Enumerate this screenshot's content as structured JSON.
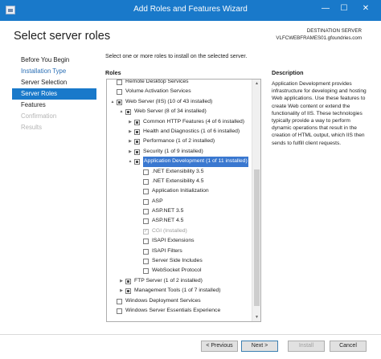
{
  "window": {
    "title": "Add Roles and Features Wizard",
    "minimize_glyph": "—",
    "maximize_glyph": "☐",
    "close_glyph": "✕"
  },
  "header": {
    "page_title": "Select server roles",
    "destination_label": "DESTINATION SERVER",
    "destination_server": "VLFCWEBFRAMES01.gfoundries.com"
  },
  "nav": {
    "items": [
      {
        "label": "Before You Begin",
        "state": "normal"
      },
      {
        "label": "Installation Type",
        "state": "link"
      },
      {
        "label": "Server Selection",
        "state": "normal"
      },
      {
        "label": "Server Roles",
        "state": "active"
      },
      {
        "label": "Features",
        "state": "normal"
      },
      {
        "label": "Confirmation",
        "state": "disabled"
      },
      {
        "label": "Results",
        "state": "disabled"
      }
    ]
  },
  "main": {
    "intro": "Select one or more roles to install on the selected server.",
    "roles_label": "Roles",
    "description_label": "Description",
    "description_text": "Application Development provides infrastructure for developing and hosting Web applications. Use these features to create Web content or extend the functionality of IIS. These technologies typically provide a way to perform dynamic operations that result in the creation of HTML output, which IIS then sends to fulfill client requests."
  },
  "roles_tree": [
    {
      "label": "Remote Desktop Services",
      "level": 0,
      "expander": "",
      "check": "unchecked"
    },
    {
      "label": "Volume Activation Services",
      "level": 0,
      "expander": "",
      "check": "unchecked"
    },
    {
      "label": "Web Server (IIS) (10 of 43 installed)",
      "level": 0,
      "expander": "▲",
      "check": "partial"
    },
    {
      "label": "Web Server (8 of 34 installed)",
      "level": 1,
      "expander": "▲",
      "check": "partial"
    },
    {
      "label": "Common HTTP Features (4 of 6 installed)",
      "level": 2,
      "expander": "▶",
      "check": "partial"
    },
    {
      "label": "Health and Diagnostics (1 of 6 installed)",
      "level": 2,
      "expander": "▶",
      "check": "partial"
    },
    {
      "label": "Performance (1 of 2 installed)",
      "level": 2,
      "expander": "▶",
      "check": "partial"
    },
    {
      "label": "Security (1 of 9 installed)",
      "level": 2,
      "expander": "▶",
      "check": "partial"
    },
    {
      "label": "Application Development (1 of 11 installed)",
      "level": 2,
      "expander": "▲",
      "check": "partial",
      "highlight": true
    },
    {
      "label": ".NET Extensibility 3.5",
      "level": 3,
      "expander": "",
      "check": "unchecked"
    },
    {
      "label": ".NET Extensibility 4.5",
      "level": 3,
      "expander": "",
      "check": "unchecked"
    },
    {
      "label": "Application Initialization",
      "level": 3,
      "expander": "",
      "check": "unchecked"
    },
    {
      "label": "ASP",
      "level": 3,
      "expander": "",
      "check": "unchecked"
    },
    {
      "label": "ASP.NET 3.5",
      "level": 3,
      "expander": "",
      "check": "unchecked"
    },
    {
      "label": "ASP.NET 4.5",
      "level": 3,
      "expander": "",
      "check": "unchecked"
    },
    {
      "label": "CGI (Installed)",
      "level": 3,
      "expander": "",
      "check": "checked",
      "disabled": true
    },
    {
      "label": "ISAPI Extensions",
      "level": 3,
      "expander": "",
      "check": "unchecked"
    },
    {
      "label": "ISAPI Filters",
      "level": 3,
      "expander": "",
      "check": "unchecked"
    },
    {
      "label": "Server Side Includes",
      "level": 3,
      "expander": "",
      "check": "unchecked"
    },
    {
      "label": "WebSocket Protocol",
      "level": 3,
      "expander": "",
      "check": "unchecked"
    },
    {
      "label": "FTP Server (1 of 2 installed)",
      "level": 1,
      "expander": "▶",
      "check": "partial"
    },
    {
      "label": "Management Tools (1 of 7 installed)",
      "level": 1,
      "expander": "▶",
      "check": "partial"
    },
    {
      "label": "Windows Deployment Services",
      "level": 0,
      "expander": "",
      "check": "unchecked"
    },
    {
      "label": "Windows Server Essentials Experience",
      "level": 0,
      "expander": "",
      "check": "unchecked"
    }
  ],
  "scrollbar": {
    "up_glyph": "▲",
    "down_glyph": "▼"
  },
  "footer": {
    "previous_label": "< Previous",
    "next_label": "Next >",
    "install_label": "Install",
    "cancel_label": "Cancel"
  }
}
